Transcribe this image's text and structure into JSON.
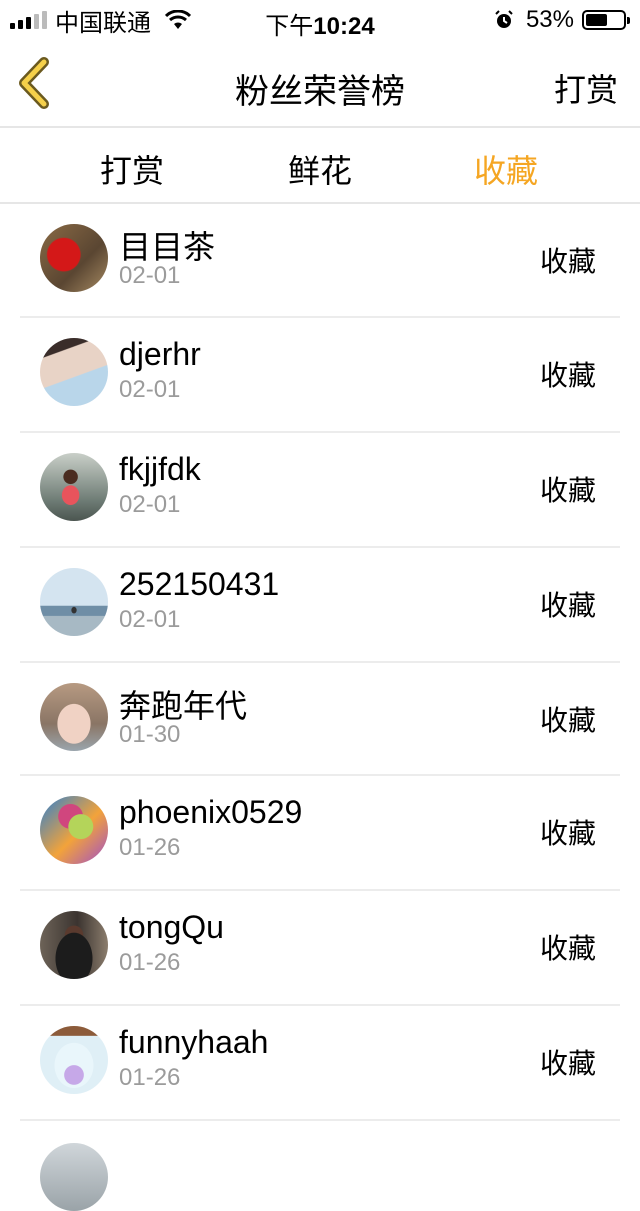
{
  "status_bar": {
    "carrier": "中国联通",
    "time_prefix": "下午",
    "time": "10:24",
    "battery": "53%"
  },
  "nav": {
    "title": "粉丝荣誉榜",
    "action": "打赏",
    "back_icon": "chevron-left-icon",
    "accent": "#f5a623"
  },
  "tabs": [
    {
      "label": "打赏",
      "active": false
    },
    {
      "label": "鲜花",
      "active": false
    },
    {
      "label": "收藏",
      "active": true
    }
  ],
  "list": [
    {
      "name": "目目茶",
      "date": "02-01",
      "type": "收藏"
    },
    {
      "name": "djerhr",
      "date": "02-01",
      "type": "收藏"
    },
    {
      "name": "fkjjfdk",
      "date": "02-01",
      "type": "收藏"
    },
    {
      "name": "252150431",
      "date": "02-01",
      "type": "收藏"
    },
    {
      "name": "奔跑年代",
      "date": "01-30",
      "type": "收藏"
    },
    {
      "name": "phoenix0529",
      "date": "01-26",
      "type": "收藏"
    },
    {
      "name": "tongQu",
      "date": "01-26",
      "type": "收藏"
    },
    {
      "name": "funnyhaah",
      "date": "01-26",
      "type": "收藏"
    }
  ]
}
